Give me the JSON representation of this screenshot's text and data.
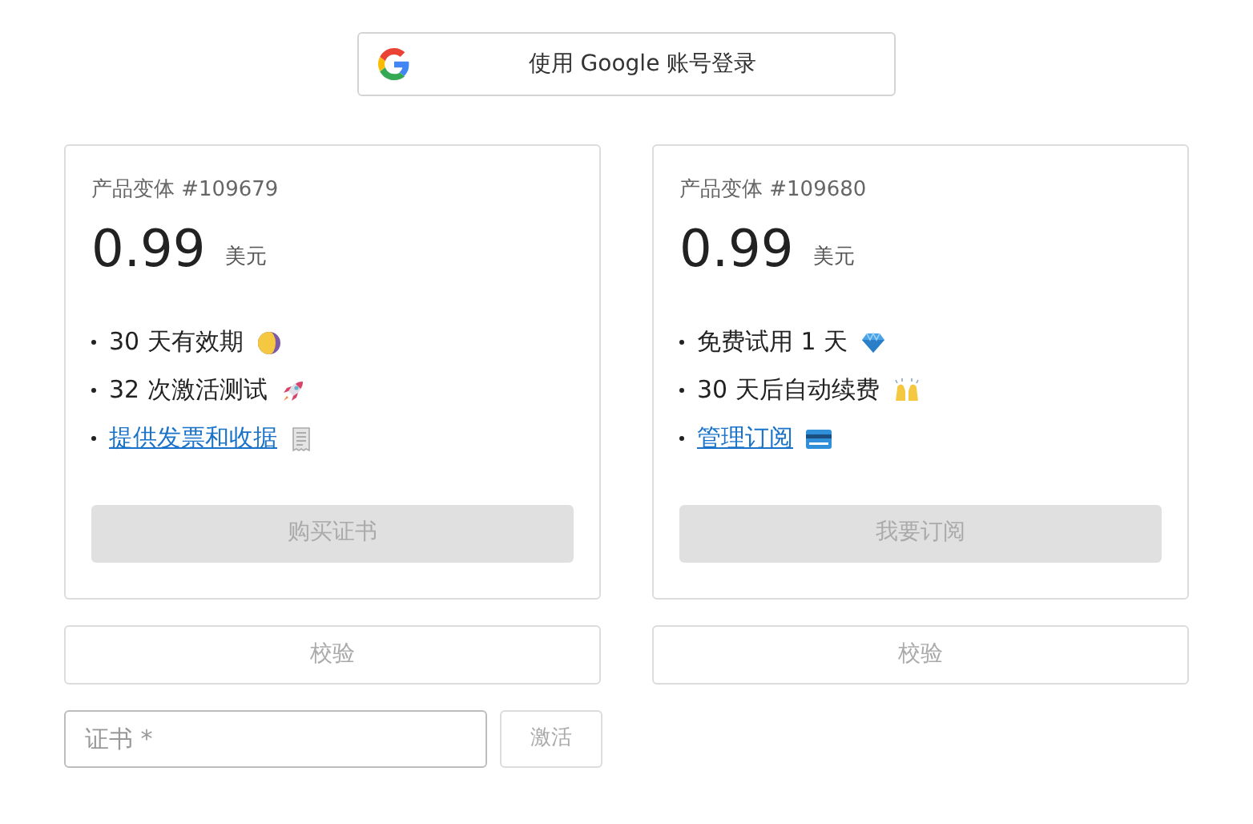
{
  "google_button": {
    "label": "使用 Google 账号登录"
  },
  "cards": [
    {
      "variant": "产品变体 #109679",
      "price": "0.99",
      "currency": "美元",
      "features": [
        {
          "kind": "text",
          "text": "30 天有效期"
        },
        {
          "kind": "text",
          "text": "32 次激活测试"
        },
        {
          "kind": "link",
          "text": "提供发票和收据"
        }
      ],
      "action": {
        "label": "购买证书",
        "disabled": true
      },
      "verify": {
        "label": "校验",
        "disabled": true
      }
    },
    {
      "variant": "产品变体 #109680",
      "price": "0.99",
      "currency": "美元",
      "features": [
        {
          "kind": "text",
          "text": "免费试用 1 天"
        },
        {
          "kind": "text",
          "text": "30 天后自动续费"
        },
        {
          "kind": "link",
          "text": "管理订阅"
        }
      ],
      "action": {
        "label": "我要订阅",
        "disabled": true
      },
      "verify": {
        "label": "校验",
        "disabled": true
      }
    }
  ],
  "license_field": {
    "placeholder": "证书 *"
  },
  "activate_button": {
    "label": "激活",
    "disabled": true
  }
}
